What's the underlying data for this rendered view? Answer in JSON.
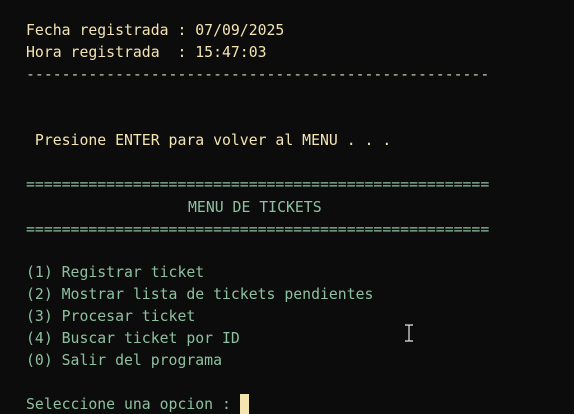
{
  "record": {
    "date_line": "Fecha registrada : 07/09/2025",
    "time_line": "Hora registrada  : 15:47:03",
    "separator": "----------------------------------------------------"
  },
  "prompt": {
    "return_message": " Presione ENTER para volver al MENU . . ."
  },
  "menu": {
    "border_top": "====================================================",
    "title": "MENU DE TICKETS",
    "border_bottom": "====================================================",
    "items": [
      {
        "label": "(1) Registrar ticket"
      },
      {
        "label": "(2) Mostrar lista de tickets pendientes"
      },
      {
        "label": "(3) Procesar ticket"
      },
      {
        "label": "(4) Buscar ticket por ID"
      },
      {
        "label": "(0) Salir del programa"
      }
    ]
  },
  "input": {
    "prompt_label": "Seleccione una opcion : "
  },
  "colors": {
    "background": "#0c0c0c",
    "text_cream": "#f3e4b0",
    "text_green": "#8dc0a0"
  },
  "icons": {
    "mouse_cursor": "i-beam-cursor-icon"
  }
}
